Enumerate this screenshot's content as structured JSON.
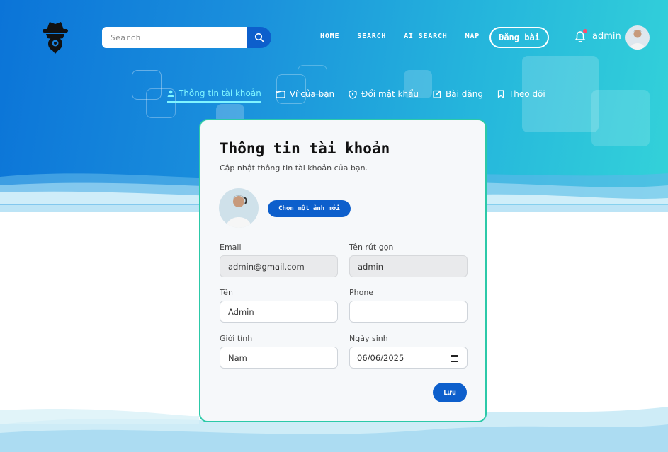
{
  "header": {
    "search": {
      "placeholder": "Search"
    },
    "nav": [
      "HOME",
      "SEARCH",
      "AI SEARCH",
      "MAP"
    ],
    "post_label": "Đăng bài",
    "username": "admin"
  },
  "tabs": [
    {
      "label": "Thông tin tài khoản",
      "icon": "user-icon",
      "active": true
    },
    {
      "label": "Ví của bạn",
      "icon": "wallet-icon",
      "active": false
    },
    {
      "label": "Đổi mật khẩu",
      "icon": "shield-icon",
      "active": false
    },
    {
      "label": "Bài đăng",
      "icon": "edit-icon",
      "active": false
    },
    {
      "label": "Theo dõi",
      "icon": "bookmark-icon",
      "active": false
    }
  ],
  "profile": {
    "title": "Thông tin tài khoản",
    "subtitle": "Cập nhật thông tin tài khoản của bạn.",
    "choose_image_label": "Chọn một ảnh mới",
    "fields": {
      "email": {
        "label": "Email",
        "value": "admin@gmail.com"
      },
      "short_name": {
        "label": "Tên rút gọn",
        "value": "admin"
      },
      "name": {
        "label": "Tên",
        "value": "Admin"
      },
      "phone": {
        "label": "Phone",
        "value": ""
      },
      "gender": {
        "label": "Giới tính",
        "value": "Nam"
      },
      "birthday": {
        "label": "Ngày sinh",
        "value": "06/06/2025"
      }
    },
    "save_label": "Lưu"
  },
  "colors": {
    "primary": "#0d5fcc",
    "accent_active_tab": "#7ff4ff",
    "card_border": "#2cc9a8",
    "notification_dot": "#ff4d6d"
  }
}
